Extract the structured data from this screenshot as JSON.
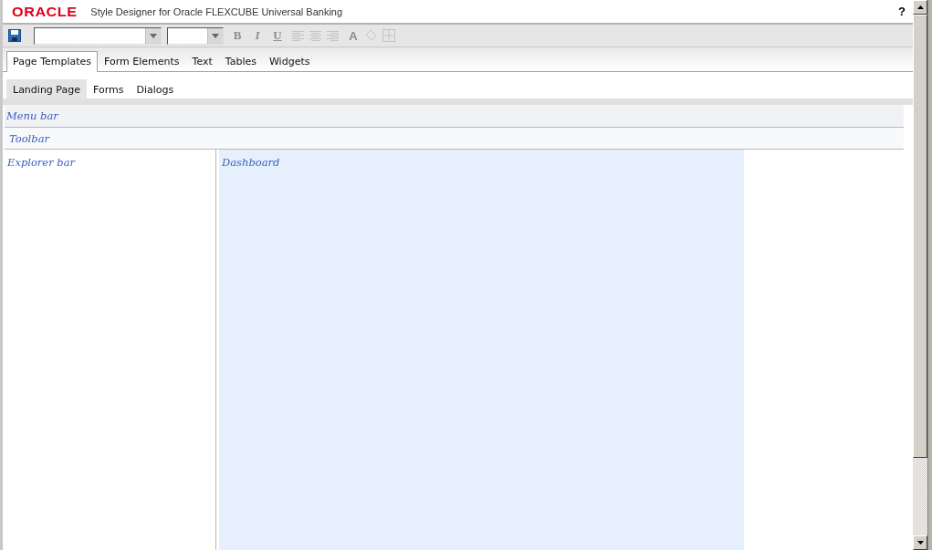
{
  "title_bar": {
    "logo": "ORACLE",
    "title": "Style Designer for Oracle FLEXCUBE Universal Banking",
    "help": "?"
  },
  "toolbar": {
    "format_buttons": [
      {
        "label": "B",
        "kind": "bold",
        "disabled": true
      },
      {
        "label": "I",
        "kind": "italic",
        "disabled": true
      },
      {
        "label": "U",
        "kind": "underline",
        "disabled": true
      }
    ],
    "color_button": {
      "label": "A",
      "disabled": true
    }
  },
  "tabs": [
    {
      "label": "Page Templates",
      "selected": true
    },
    {
      "label": "Form Elements",
      "selected": false
    },
    {
      "label": "Text",
      "selected": false
    },
    {
      "label": "Tables",
      "selected": false
    },
    {
      "label": "Widgets",
      "selected": false
    }
  ],
  "subtabs": [
    {
      "label": "Landing Page",
      "selected": true
    },
    {
      "label": "Forms",
      "selected": false
    },
    {
      "label": "Dialogs",
      "selected": false
    }
  ],
  "regions": {
    "menu_bar": "Menu bar",
    "toolbar": "Toolbar",
    "explorer_bar": "Explorer bar",
    "dashboard": "Dashboard"
  }
}
